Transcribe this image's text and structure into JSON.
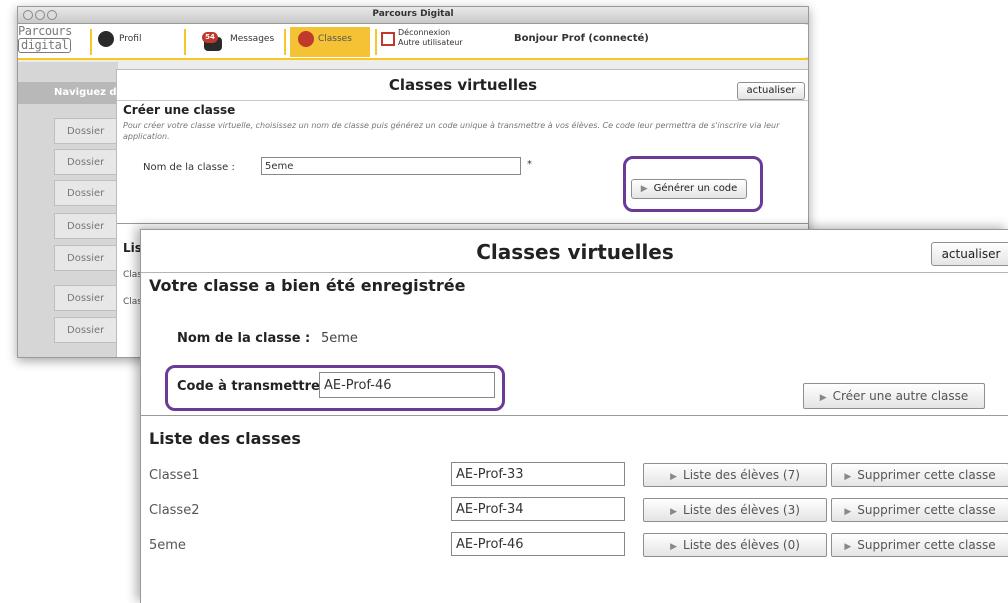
{
  "window": {
    "title": "Parcours Digital"
  },
  "app": {
    "logo_line1": "Parcours",
    "logo_line2": "digital",
    "nav": {
      "profil": "Profil",
      "messages": "Messages",
      "messages_badge": "54",
      "classes": "Classes",
      "logout_line1": "Déconnexion",
      "logout_line2": "Autre utilisateur",
      "greeting": "Bonjour Prof (connecté)"
    },
    "sidebar": {
      "header": "Naviguez d",
      "items": [
        "Dossier",
        "Dossier",
        "Dossier",
        "Dossier",
        "Dossier",
        "Dossier",
        "Dossier"
      ]
    }
  },
  "back_panel": {
    "heading": "Classes virtuelles",
    "refresh_label": "actualiser",
    "create_heading": "Créer une classe",
    "create_description": "Pour créer votre classe virtuelle, choisissez un nom de classe puis générez un code unique à transmettre à vos élèves. Ce code leur permettra de s'inscrire via leur application.",
    "name_label": "Nom de la classe :",
    "name_value": "5eme",
    "required_mark": "*",
    "generate_label": "Générer un code",
    "list_heading_partial": "Lis",
    "row_labels": [
      "Clas",
      "Clas"
    ]
  },
  "front_panel": {
    "heading": "Classes virtuelles",
    "refresh_label": "actualiser",
    "saved_heading": "Votre classe a bien été enregistrée",
    "class_name_label": "Nom de la classe :",
    "class_name_value": "5eme",
    "code_label": "Code à transmettre :",
    "code_value": "AE-Prof-46",
    "create_another_label": "Créer une autre classe",
    "list_heading": "Liste des classes",
    "classes": [
      {
        "name": "Classe1",
        "code": "AE-Prof-33",
        "students_label": "Liste des élèves (7)",
        "delete_label": "Supprimer cette classe"
      },
      {
        "name": "Classe2",
        "code": "AE-Prof-34",
        "students_label": "Liste des élèves (3)",
        "delete_label": "Supprimer cette classe"
      },
      {
        "name": "5eme",
        "code": "AE-Prof-46",
        "students_label": "Liste des élèves (0)",
        "delete_label": "Supprimer cette classe"
      }
    ]
  },
  "colors": {
    "header_yellow": "#f6c823",
    "highlight_ring": "#6b3a96"
  }
}
